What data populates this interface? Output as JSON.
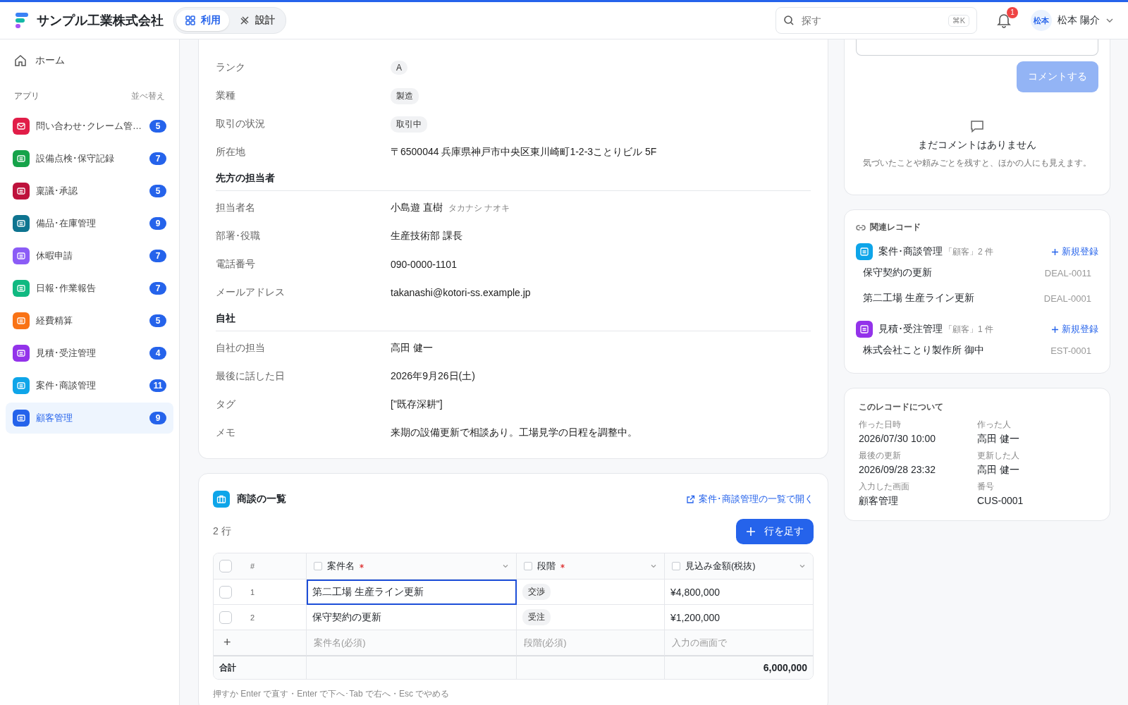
{
  "header": {
    "company": "サンプル工業株式会社",
    "modes": [
      {
        "label": "利用",
        "selected": true
      },
      {
        "label": "設計",
        "selected": false
      }
    ],
    "search": {
      "placeholder": "探す",
      "shortcut": "⌘K"
    },
    "notifications": "1",
    "user": {
      "initials": "松本",
      "name": "松本 陽介"
    }
  },
  "sidebar": {
    "home": "ホーム",
    "section": "アプリ",
    "sort": "並べ替え",
    "items": [
      {
        "label": "問い合わせ･クレーム管…",
        "count": "5",
        "color": "#e11d48",
        "selected": false
      },
      {
        "label": "設備点検･保守記録",
        "count": "7",
        "color": "#16a34a",
        "selected": false
      },
      {
        "label": "稟議･承認",
        "count": "5",
        "color": "#be123c",
        "selected": false
      },
      {
        "label": "備品･在庫管理",
        "count": "9",
        "color": "#0e7490",
        "selected": false
      },
      {
        "label": "休暇申請",
        "count": "7",
        "color": "#8b5cf6",
        "selected": false
      },
      {
        "label": "日報･作業報告",
        "count": "7",
        "color": "#10b981",
        "selected": false
      },
      {
        "label": "経費精算",
        "count": "5",
        "color": "#f97316",
        "selected": false
      },
      {
        "label": "見積･受注管理",
        "count": "4",
        "color": "#9333ea",
        "selected": false
      },
      {
        "label": "案件･商談管理",
        "count": "11",
        "color": "#0ea5e9",
        "selected": false
      },
      {
        "label": "顧客管理",
        "count": "9",
        "color": "#2563eb",
        "selected": true
      }
    ]
  },
  "record": {
    "sections": [
      {
        "fields": [
          {
            "label": "ランク",
            "value": "A",
            "kind": "chip"
          },
          {
            "label": "業種",
            "value": "製造",
            "kind": "chip"
          },
          {
            "label": "取引の状況",
            "value": "取引中",
            "kind": "chip"
          },
          {
            "label": "所在地",
            "value": "〒6500044 兵庫県神戸市中央区東川崎町1-2-3ことりビル 5F",
            "kind": "text"
          }
        ]
      },
      {
        "heading": "先方の担当者",
        "fields": [
          {
            "label": "担当者名",
            "value": "小島遊 直樹",
            "reading": "タカナシ ナオキ",
            "kind": "text"
          },
          {
            "label": "部署･役職",
            "value": "生産技術部 課長",
            "kind": "text"
          },
          {
            "label": "電話番号",
            "value": "090-0000-1101",
            "kind": "text"
          },
          {
            "label": "メールアドレス",
            "value": "takanashi@kotori-ss.example.jp",
            "kind": "text"
          }
        ]
      },
      {
        "heading": "自社",
        "fields": [
          {
            "label": "自社の担当",
            "value": "高田 健一",
            "kind": "text"
          },
          {
            "label": "最後に話した日",
            "value": "2026年9月26日(土)",
            "kind": "text"
          },
          {
            "label": "タグ",
            "value": "[\"既存深耕\"]",
            "kind": "text"
          },
          {
            "label": "メモ",
            "value": "来期の設備更新で相談あり。工場見学の日程を調整中。",
            "kind": "text"
          }
        ]
      }
    ]
  },
  "deals": {
    "title": "商談の一覧",
    "open_link": "案件･商談管理の一覧で開く",
    "row_count": "2 行",
    "add_button": "行を足す",
    "all_checked": false,
    "columns": [
      {
        "label": "#"
      },
      {
        "label": "案件名",
        "required": true,
        "checked": false
      },
      {
        "label": "段階",
        "required": true,
        "checked": false
      },
      {
        "label": "見込み金額(税抜)",
        "required": false,
        "checked": false
      }
    ],
    "rows": [
      {
        "num": "1",
        "name": "第二工場 生産ライン更新",
        "stage": "交渉",
        "amount": "¥4,800,000",
        "checked": false,
        "selected": true
      },
      {
        "num": "2",
        "name": "保守契約の更新",
        "stage": "受注",
        "amount": "¥1,200,000",
        "checked": false,
        "selected": false
      }
    ],
    "new_row": {
      "add": "+",
      "name_placeholder": "案件名(必須)",
      "stage_placeholder": "段階(必須)",
      "amount_placeholder": "入力の画面で"
    },
    "total_label": "合計",
    "total": "6,000,000",
    "hint": "押すか Enter で直す・Enter で下へ･Tab で右へ・Esc でやめる"
  },
  "comments": {
    "button": "コメントする",
    "empty_title": "まだコメントはありません",
    "empty_text": "気づいたことや頼みごとを残すと、ほかの人にも見えます。"
  },
  "related": {
    "title": "関連レコード",
    "groups": [
      {
        "name": "案件･商談管理",
        "context": "「顧客」2 件",
        "color": "#0ea5e9",
        "new": "新規登録",
        "records": [
          {
            "title": "保守契約の更新",
            "id": "DEAL-0011"
          },
          {
            "title": "第二工場 生産ライン更新",
            "id": "DEAL-0001"
          }
        ]
      },
      {
        "name": "見積･受注管理",
        "context": "「顧客」1 件",
        "color": "#9333ea",
        "new": "新規登録",
        "records": [
          {
            "title": "株式会社ことり製作所 御中",
            "id": "EST-0001"
          }
        ]
      }
    ]
  },
  "about": {
    "title": "このレコードについて",
    "items": [
      {
        "label": "作った日時",
        "value": "2026/07/30 10:00"
      },
      {
        "label": "作った人",
        "value": "高田 健一"
      },
      {
        "label": "最後の更新",
        "value": "2026/09/28 23:32"
      },
      {
        "label": "更新した人",
        "value": "高田 健一"
      },
      {
        "label": "入力した画面",
        "value": "顧客管理"
      },
      {
        "label": "番号",
        "value": "CUS-0001"
      }
    ]
  }
}
